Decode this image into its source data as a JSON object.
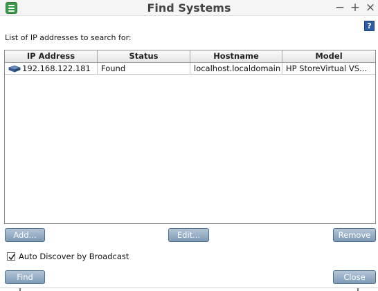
{
  "window": {
    "title": "Find Systems",
    "minimize_glyph": "−",
    "maximize_glyph": "+",
    "close_glyph": "×",
    "app_icon": "storage-app-icon"
  },
  "help": {
    "label": "?",
    "icon": "help-icon"
  },
  "list_label": "List of IP addresses to search for:",
  "table": {
    "columns": [
      "IP Address",
      "Status",
      "Hostname",
      "Model"
    ],
    "rows": [
      {
        "ip": "192.168.122.181",
        "status": "Found",
        "hostname": "localhost.localdomain",
        "model": "HP StoreVirtual VS...",
        "icon": "storage-node-icon"
      }
    ]
  },
  "buttons": {
    "add": "Add...",
    "edit": "Edit...",
    "remove": "Remove",
    "find": "Find",
    "close": "Close"
  },
  "auto_discover": {
    "label": "Auto Discover by Broadcast",
    "checked": true
  },
  "colors": {
    "button_top": "#b3c6d8",
    "button_bottom": "#7e9ab6",
    "help_blue": "#2e5da8",
    "app_icon_green": "#3a9a4a"
  }
}
